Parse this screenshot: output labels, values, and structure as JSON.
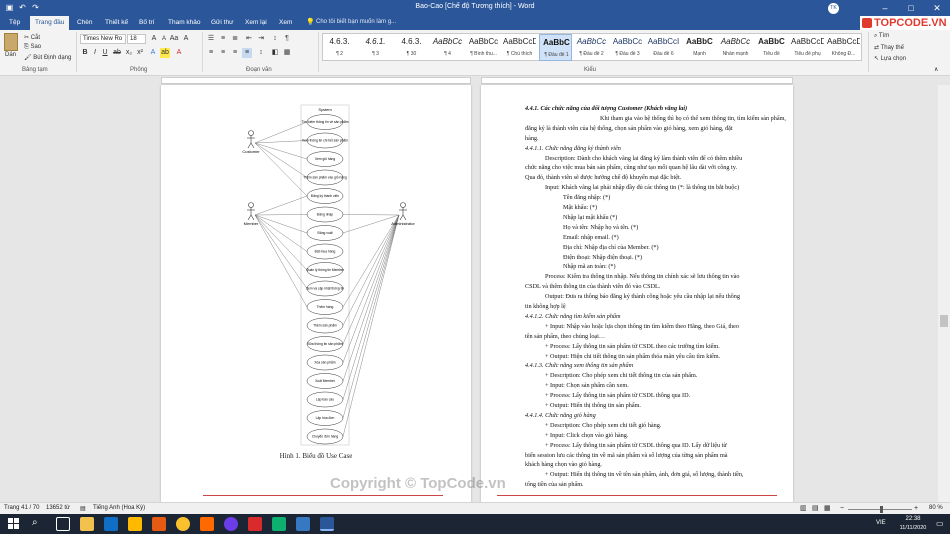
{
  "window": {
    "title": "Bao-Cao [Chế độ Tương thích] - Word",
    "user_initials": "TK"
  },
  "ribbon_tabs": [
    "Tệp",
    "Trang đầu",
    "Chèn",
    "Thiết kế",
    "Bố trí",
    "Tham khảo",
    "Gửi thư",
    "Xem lại",
    "Xem"
  ],
  "tell_me": "Cho tôi biết bạn muốn làm g...",
  "clipboard": {
    "paste": "Dán",
    "cut": "Cắt",
    "copy": "Sao",
    "format_painter": "Bút Định dạng",
    "group": "Bảng tạm"
  },
  "font": {
    "name": "Times New Ro",
    "size": "18",
    "group": "Phông"
  },
  "paragraph": {
    "group": "Đoạn văn"
  },
  "styles": {
    "group": "Kiểu",
    "items": [
      {
        "preview": "4.6.3.",
        "label": "¶ 2"
      },
      {
        "preview": "4.6.1.",
        "label": "¶ 3"
      },
      {
        "preview": "4.6.3.",
        "label": "¶ 30"
      },
      {
        "preview": "AaBbCc",
        "label": "¶ 4"
      },
      {
        "preview": "AaBbCc",
        "label": "¶ Bình thu..."
      },
      {
        "preview": "AaBbCcD",
        "label": "¶ Chú thích"
      },
      {
        "preview": "AaBbC",
        "label": "¶ Đầu đề 1"
      },
      {
        "preview": "AaBbCc",
        "label": "¶ Đầu đề 2"
      },
      {
        "preview": "AaBbCc",
        "label": "¶ Đầu đề 3"
      },
      {
        "preview": "AaBbCcI",
        "label": "Đầu đề 6"
      },
      {
        "preview": "AaBbC",
        "label": "Mạnh"
      },
      {
        "preview": "AaBbCc",
        "label": "Nhấn mạnh"
      },
      {
        "preview": "AaBbC",
        "label": "Tiêu đề"
      },
      {
        "preview": "AaBbCcD",
        "label": "Tiêu đề phụ"
      },
      {
        "preview": "AaBbCcDc",
        "label": "Không Đ..."
      }
    ]
  },
  "editing": {
    "find": "Tìm",
    "replace": "Thay thế",
    "select": "Lựa chọn"
  },
  "diagram": {
    "title": "System",
    "actors": [
      "Customer",
      "Member",
      "Administrator"
    ],
    "use_cases": [
      "Tìm kiếm thông tin về sản phẩm",
      "Xem thông tin chi tiết sản phẩm",
      "Xem giỏ hàng",
      "Thêm sản phẩm vào giỏ hàng",
      "Đăng ký thành viên",
      "Đăng nhập",
      "Đăng xuất",
      "Đặt mua hàng",
      "Quản lý thông tin Member",
      "Xem và cập nhật thông tin",
      "Thêm hàng",
      "Thêm sản phẩm",
      "Sửa thông tin sản phẩm",
      "Xóa sản phẩm",
      "Xuất Member",
      "Lập báo cáo",
      "Lập hóa đơn",
      "Chuyển đơn hàng"
    ],
    "caption": "Hình 1. Biểu đồ Use Case"
  },
  "page2": {
    "lines": [
      {
        "text": "4.4.1. Các chức năng của đối tượng Customer (Khách vãng lai)",
        "style": "hb",
        "indent": 0
      },
      {
        "text": "Khi tham gia vào hệ thống thì họ có thể xem thông tin, tìm kiếm sản phẩm,",
        "style": "",
        "indent": 75
      },
      {
        "text": "đăng ký là thành viên của hệ thống, chọn sản phẩm vào giỏ hàng, xem giỏ hàng, đặt",
        "style": "",
        "indent": 0
      },
      {
        "text": "hàng.",
        "style": "",
        "indent": 0
      },
      {
        "text": "4.4.1.1. Chức năng đăng ký thành viên",
        "style": "h",
        "indent": 0
      },
      {
        "text": "Description: Dành cho khách vãng lai đăng ký làm thành viên để có thêm nhiều",
        "style": "",
        "indent": 20
      },
      {
        "text": "chức năng cho việc mua bán sản phẩm, cũng như tạo mối quan hệ lâu dài với công ty.",
        "style": "",
        "indent": 0
      },
      {
        "text": "Qua đó, thành viên sẽ được hưởng chế độ khuyến mại đặc biệt.",
        "style": "",
        "indent": 0
      },
      {
        "text": "Input: Khách vãng lai phải nhập đầy đủ các thông tin (*: là thông tin bắt buộc)",
        "style": "",
        "indent": 20
      },
      {
        "text": "Tên đăng nhập: (*)",
        "style": "",
        "indent": 38
      },
      {
        "text": "Mật khẩu: (*)",
        "style": "",
        "indent": 38
      },
      {
        "text": "Nhập lại mật khẩu (*)",
        "style": "",
        "indent": 38
      },
      {
        "text": "Họ và tên: Nhập họ và tên. (*)",
        "style": "",
        "indent": 38
      },
      {
        "text": "Email: nhập email. (*)",
        "style": "",
        "indent": 38
      },
      {
        "text": "Địa chỉ: Nhập địa chỉ của Member. (*)",
        "style": "",
        "indent": 38
      },
      {
        "text": "Điện thoại: Nhập điện thoại. (*)",
        "style": "",
        "indent": 38
      },
      {
        "text": "Nhập mã an toàn: (*)",
        "style": "",
        "indent": 38
      },
      {
        "text": "Process: Kiểm tra thông tin nhập. Nếu thông tin chính xác sẽ lưu thông tin vào",
        "style": "",
        "indent": 20
      },
      {
        "text": "CSDL và thêm thông tin của thành viên đó vào CSDL.",
        "style": "",
        "indent": 0
      },
      {
        "text": "Output: Đưa ra thông báo đăng ký thành công hoặc yêu cầu nhập lại nếu thông",
        "style": "",
        "indent": 20
      },
      {
        "text": "tin không hợp lệ",
        "style": "",
        "indent": 0
      },
      {
        "text": "4.4.1.2. Chức năng tìm kiếm sản phẩm",
        "style": "h",
        "indent": 0
      },
      {
        "text": "+ Input: Nhập vào hoặc lựa chọn thông tin tìm kiếm theo Hãng, theo Giá, theo",
        "style": "",
        "indent": 20
      },
      {
        "text": "tên sản phẩm, theo chủng loại…",
        "style": "",
        "indent": 0
      },
      {
        "text": "+ Process: Lấy thông tin sản phẩm từ CSDL theo các trường tìm kiếm.",
        "style": "",
        "indent": 20
      },
      {
        "text": "+ Output: Hiện chi tiết thông tin sản phẩm thỏa mãn yêu cầu tìm kiếm.",
        "style": "",
        "indent": 20
      },
      {
        "text": "4.4.1.3. Chức năng xem thông tin sản phẩm",
        "style": "h",
        "indent": 0
      },
      {
        "text": "+ Description: Cho phép xem chi tiết thông tin của sản phẩm.",
        "style": "",
        "indent": 20
      },
      {
        "text": "+ Input: Chọn sản phẩm cần xem.",
        "style": "",
        "indent": 20
      },
      {
        "text": "+ Process: Lấy thông tin sản phẩm từ CSDL thông qua ID.",
        "style": "",
        "indent": 20
      },
      {
        "text": "+ Output: Hiển thị thông tin sản phẩm.",
        "style": "",
        "indent": 20
      },
      {
        "text": "4.4.1.4. Chức năng giỏ hàng",
        "style": "h",
        "indent": 0
      },
      {
        "text": "+ Description: Cho phép xem chi tiết giỏ hàng.",
        "style": "",
        "indent": 20
      },
      {
        "text": "+ Input: Click chọn vào giỏ hàng.",
        "style": "",
        "indent": 20
      },
      {
        "text": "+ Process: Lấy thông tin sản phẩm từ CSDL thông qua ID. Lấy dữ liệu từ",
        "style": "",
        "indent": 20
      },
      {
        "text": "biến session lưu các thông tin về mã sản phẩm và số lượng của từng sản phẩm mà",
        "style": "",
        "indent": 0
      },
      {
        "text": "khách hàng chọn vào giỏ hàng.",
        "style": "",
        "indent": 0
      },
      {
        "text": "+ Output: Hiển thị thông tin về tên sản phẩm, ảnh, đơn giá, số lượng, thành tiền,",
        "style": "",
        "indent": 20
      },
      {
        "text": "tổng tiền của sản phẩm.",
        "style": "",
        "indent": 0
      }
    ]
  },
  "status": {
    "page": "Trang 41 / 70",
    "words": "13652 từ",
    "language": "Tiếng Anh (Hoa Kỳ)",
    "zoom": "80 %"
  },
  "taskbar": {
    "time": "22:38",
    "date": "11/11/2020",
    "lang": "VIE"
  },
  "watermark": {
    "brand": "TOPCODE.VN",
    "copyright": "Copyright © TopCode.vn"
  }
}
